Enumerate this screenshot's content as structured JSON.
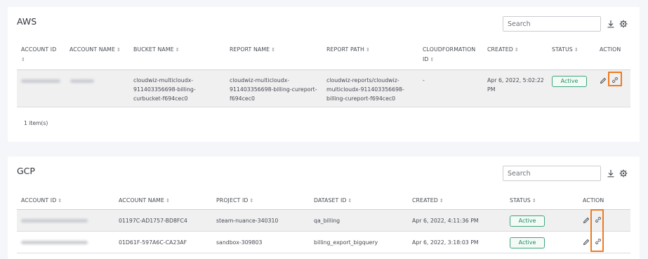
{
  "aws": {
    "title": "AWS",
    "search_placeholder": "Search",
    "columns": [
      "ACCOUNT ID",
      "ACCOUNT NAME",
      "BUCKET NAME",
      "REPORT NAME",
      "REPORT PATH",
      "CLOUDFORMATION ID",
      "CREATED",
      "STATUS",
      "ACTION"
    ],
    "rows": [
      {
        "bucket_name": [
          "cloudwiz-multicloudx-",
          "911403356698-billing-",
          "curbucket-f694cec0"
        ],
        "report_name": [
          "cloudwiz-multicloudx-",
          "911403356698-billing-cureport-",
          "f694cec0"
        ],
        "report_path": [
          "cloudwiz-reports/cloudwiz-",
          "multicloudx-911403356698-",
          "billing-cureport-f694cec0"
        ],
        "cloudformation_id": "-",
        "created": [
          "Apr 6, 2022, 5:02:22",
          "PM"
        ],
        "status": "Active"
      }
    ],
    "footer": "1 item(s)"
  },
  "gcp": {
    "title": "GCP",
    "search_placeholder": "Search",
    "columns": [
      "ACCOUNT ID",
      "ACCOUNT NAME",
      "PROJECT ID",
      "DATASET ID",
      "CREATED",
      "STATUS",
      "ACTION"
    ],
    "rows": [
      {
        "account_name": "01197C-AD1757-BD8FC4",
        "project_id": "steam-nuance-340310",
        "dataset_id": "qa_billing",
        "created": "Apr 6, 2022, 4:11:36 PM",
        "status": "Active"
      },
      {
        "account_name": "01D61F-597A6C-CA23AF",
        "project_id": "sandbox-309803",
        "dataset_id": "billing_export_bigquery",
        "created": "Apr 6, 2022, 3:18:03 PM",
        "status": "Active"
      }
    ]
  },
  "icons": {
    "download": "download-icon",
    "settings": "gear-icon",
    "edit": "pencil-icon",
    "link": "link-icon",
    "sort": "sort-icon"
  },
  "colors": {
    "status_active": "#1f8f60",
    "highlight": "#f07a1e",
    "row_shade": "#f0f0f1"
  },
  "sort_glyph": "⇕"
}
